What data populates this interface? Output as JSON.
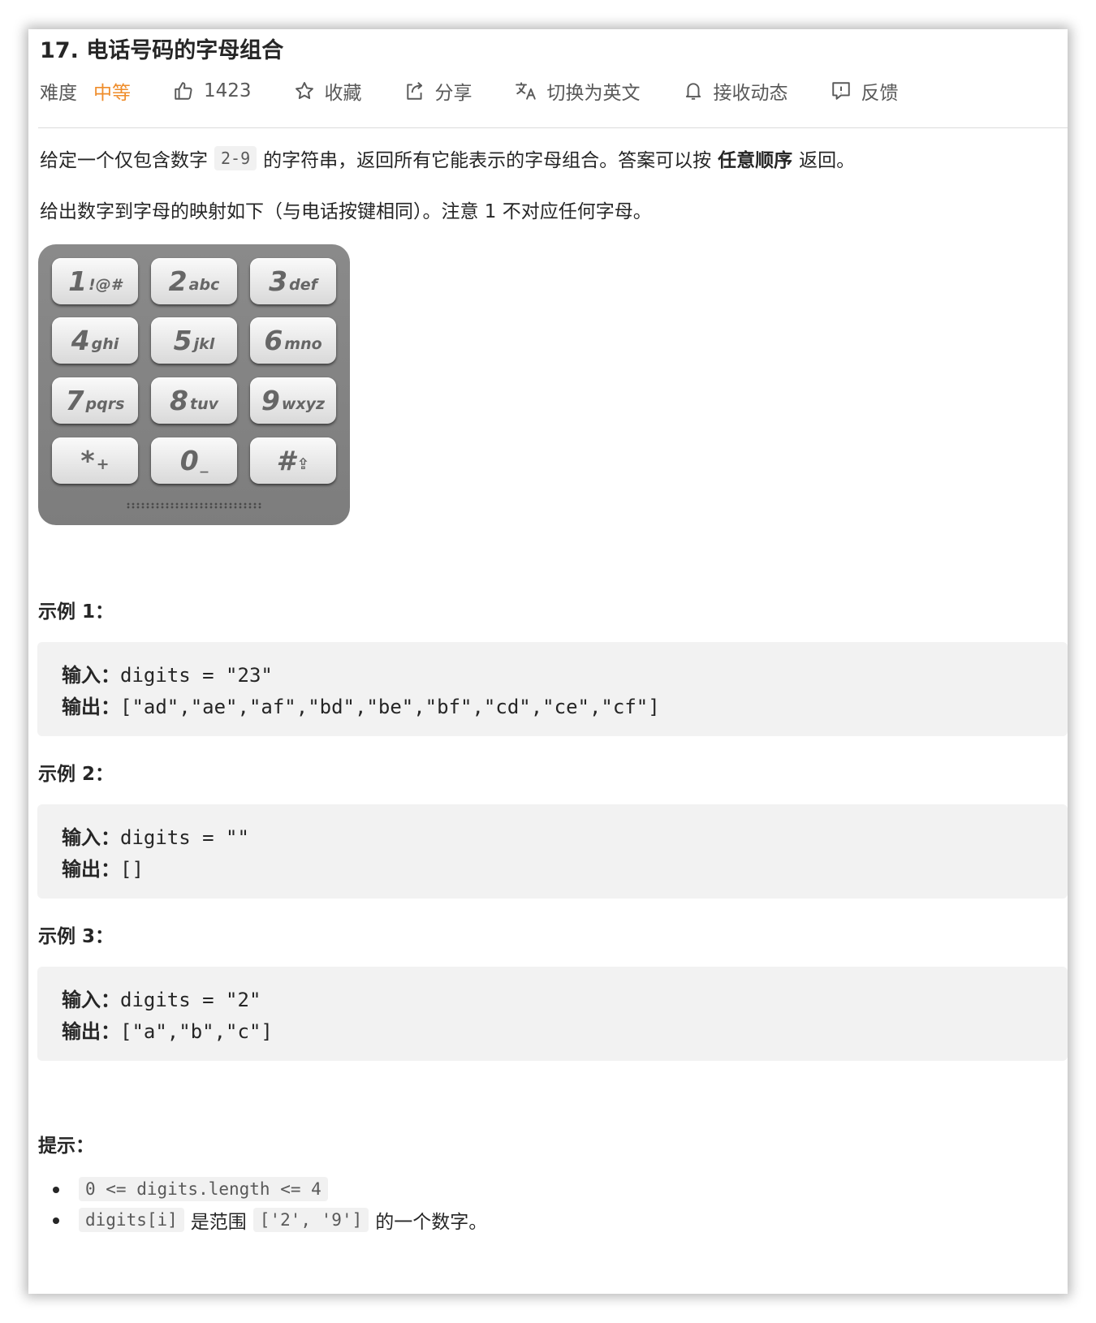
{
  "problem": {
    "title": "17. 电话号码的字母组合",
    "difficulty_label": "难度",
    "difficulty_value": "中等",
    "likes": "1423",
    "favorite_label": "收藏",
    "share_label": "分享",
    "translate_label": "切换为英文",
    "subscribe_label": "接收动态",
    "feedback_label": "反馈"
  },
  "description": {
    "p1_before": "给定一个仅包含数字",
    "p1_code": "2-9",
    "p1_middle": "的字符串，返回所有它能表示的字母组合。答案可以按",
    "p1_bold": "任意顺序",
    "p1_after": "返回。",
    "p2": "给出数字到字母的映射如下（与电话按键相同）。注意 1 不对应任何字母。"
  },
  "keypad": [
    {
      "num": "1",
      "sub": "!@#"
    },
    {
      "num": "2",
      "sub": "abc"
    },
    {
      "num": "3",
      "sub": "def"
    },
    {
      "num": "4",
      "sub": "ghi"
    },
    {
      "num": "5",
      "sub": "jkl"
    },
    {
      "num": "6",
      "sub": "mno"
    },
    {
      "num": "7",
      "sub": "pqrs"
    },
    {
      "num": "8",
      "sub": "tuv"
    },
    {
      "num": "9",
      "sub": "wxyz"
    },
    {
      "num": "*",
      "sub": "+"
    },
    {
      "num": "0",
      "sub": "_"
    },
    {
      "num": "#",
      "sub": "⇪"
    }
  ],
  "examples": [
    {
      "title": "示例 1：",
      "input_label": "输入：",
      "input": "digits = \"23\"",
      "output_label": "输出：",
      "output": "[\"ad\",\"ae\",\"af\",\"bd\",\"be\",\"bf\",\"cd\",\"ce\",\"cf\"]"
    },
    {
      "title": "示例 2：",
      "input_label": "输入：",
      "input": "digits = \"\"",
      "output_label": "输出：",
      "output": "[]"
    },
    {
      "title": "示例 3：",
      "input_label": "输入：",
      "input": "digits = \"2\"",
      "output_label": "输出：",
      "output": "[\"a\",\"b\",\"c\"]"
    }
  ],
  "hints": {
    "title": "提示：",
    "c1_code": "0 <= digits.length <= 4",
    "c2_code1": "digits[i]",
    "c2_text1": "是范围",
    "c2_code2": "['2', '9']",
    "c2_text2": "的一个数字。"
  },
  "colors": {
    "difficulty_medium": "#ef8d2b",
    "code_background": "#f2f2f2"
  }
}
